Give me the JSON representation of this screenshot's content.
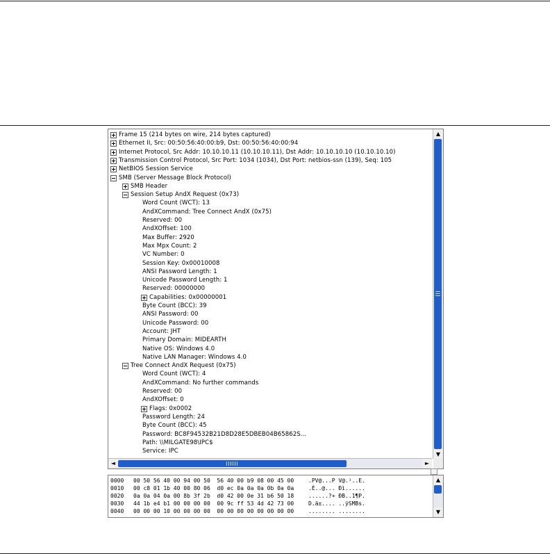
{
  "tree": [
    {
      "text": "Frame 15 (214 bytes on wire, 214 bytes captured)",
      "level": 0,
      "state": "collapsed"
    },
    {
      "text": "Ethernet II, Src: 00:50:56:40:00:b9, Dst: 00:50:56:40:00:94",
      "level": 0,
      "state": "collapsed"
    },
    {
      "text": "Internet Protocol, Src Addr: 10.10.10.11 (10.10.10.11), Dst Addr: 10.10.10.10 (10.10.10.10)",
      "level": 0,
      "state": "collapsed"
    },
    {
      "text": "Transmission Control Protocol, Src Port: 1034 (1034), Dst Port: netbios-ssn (139), Seq: 105",
      "level": 0,
      "state": "collapsed"
    },
    {
      "text": "NetBIOS Session Service",
      "level": 0,
      "state": "collapsed"
    },
    {
      "text": "SMB (Server Message Block Protocol)",
      "level": 0,
      "state": "expanded"
    },
    {
      "text": "SMB Header",
      "level": 1,
      "state": "collapsed"
    },
    {
      "text": "Session Setup AndX Request (0x73)",
      "level": 1,
      "state": "expanded"
    },
    {
      "text": "Word Count (WCT): 13",
      "level": 2,
      "state": "leaf"
    },
    {
      "text": "AndXCommand: Tree Connect AndX (0x75)",
      "level": 2,
      "state": "leaf"
    },
    {
      "text": "Reserved: 00",
      "level": 2,
      "state": "leaf"
    },
    {
      "text": "AndXOffset: 100",
      "level": 2,
      "state": "leaf"
    },
    {
      "text": "Max Buffer: 2920",
      "level": 2,
      "state": "leaf"
    },
    {
      "text": "Max Mpx Count: 2",
      "level": 2,
      "state": "leaf"
    },
    {
      "text": "VC Number: 0",
      "level": 2,
      "state": "leaf"
    },
    {
      "text": "Session Key: 0x00010008",
      "level": 2,
      "state": "leaf"
    },
    {
      "text": "ANSI Password Length: 1",
      "level": 2,
      "state": "leaf"
    },
    {
      "text": "Unicode Password Length: 1",
      "level": 2,
      "state": "leaf"
    },
    {
      "text": "Reserved: 00000000",
      "level": 2,
      "state": "leaf"
    },
    {
      "text": "Capabilities: 0x00000001",
      "level": 2,
      "state": "collapsed"
    },
    {
      "text": "Byte Count (BCC): 39",
      "level": 2,
      "state": "leaf"
    },
    {
      "text": "ANSI Password: 00",
      "level": 2,
      "state": "leaf"
    },
    {
      "text": "Unicode Password: 00",
      "level": 2,
      "state": "leaf"
    },
    {
      "text": "Account: JHT",
      "level": 2,
      "state": "leaf"
    },
    {
      "text": "Primary Domain: MIDEARTH",
      "level": 2,
      "state": "leaf"
    },
    {
      "text": "Native OS: Windows 4.0",
      "level": 2,
      "state": "leaf"
    },
    {
      "text": "Native LAN Manager: Windows 4.0",
      "level": 2,
      "state": "leaf"
    },
    {
      "text": "Tree Connect AndX Request (0x75)",
      "level": 1,
      "state": "expanded"
    },
    {
      "text": "Word Count (WCT): 4",
      "level": 2,
      "state": "leaf"
    },
    {
      "text": "AndXCommand: No further commands",
      "level": 2,
      "state": "leaf"
    },
    {
      "text": "Reserved: 00",
      "level": 2,
      "state": "leaf"
    },
    {
      "text": "AndXOffset: 0",
      "level": 2,
      "state": "leaf"
    },
    {
      "text": "Flags: 0x0002",
      "level": 2,
      "state": "collapsed"
    },
    {
      "text": "Password Length: 24",
      "level": 2,
      "state": "leaf"
    },
    {
      "text": "Byte Count (BCC): 45",
      "level": 2,
      "state": "leaf"
    },
    {
      "text": "Password: BC8F94532B21D8D28E5DBEB04B65862S...",
      "level": 2,
      "state": "leaf"
    },
    {
      "text": "Path: \\\\MILGATE98\\IPC$",
      "level": 2,
      "state": "leaf"
    },
    {
      "text": "Service: IPC",
      "level": 2,
      "state": "leaf"
    }
  ],
  "bytes": [
    {
      "offset": "0000",
      "hex": "00 50 56 40 00 94 00 50  56 40 00 b9 08 00 45 00",
      "ascii": ".PV@...P V@.¹..E."
    },
    {
      "offset": "0010",
      "hex": "00 c8 01 1b 40 00 80 06  d0 ec 0a 0a 0a 0b 0a 0a",
      "ascii": ".È..@... Ðì......"
    },
    {
      "offset": "0020",
      "hex": "0a 0a 04 0a 00 8b 3f 2b  d0 42 00 0e 31 b6 50 18",
      "ascii": "......?+ ÐB..1¶P."
    },
    {
      "offset": "0030",
      "hex": "44 1b e4 b1 00 00 00 00  00 9c ff 53 4d 42 73 00",
      "ascii": "D.ä±.... ..ÿSMBs."
    },
    {
      "offset": "0040",
      "hex": "00 00 00 10 00 00 00 00  00 00 00 00 00 00 00 00",
      "ascii": "........ ........"
    }
  ],
  "icons": {
    "scroll_up": "▲",
    "scroll_down": "▼",
    "scroll_left": "◄",
    "scroll_right": "►",
    "expand": "plus-box-icon",
    "collapse": "minus-box-icon"
  }
}
